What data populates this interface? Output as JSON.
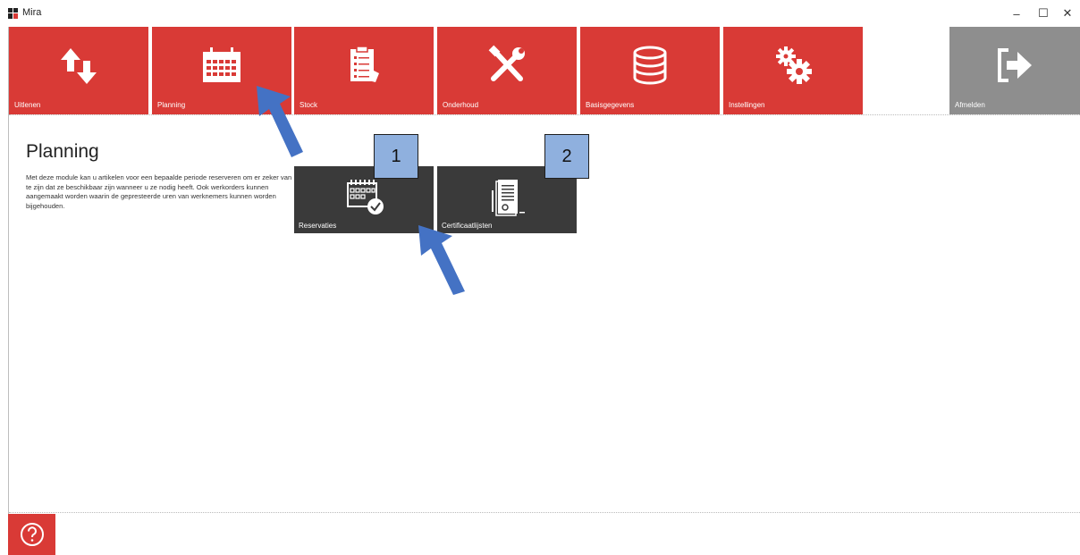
{
  "window": {
    "title": "Mira",
    "minimize_glyph": "–",
    "maximize_glyph": "☐",
    "close_glyph": "✕"
  },
  "nav": {
    "tiles": [
      {
        "label": "Uitlenen",
        "icon": "up-down-arrows-icon"
      },
      {
        "label": "Planning",
        "icon": "calendar-icon"
      },
      {
        "label": "Stock",
        "icon": "clipboard-list-icon"
      },
      {
        "label": "Onderhoud",
        "icon": "tools-icon"
      },
      {
        "label": "Basisgegevens",
        "icon": "database-icon"
      },
      {
        "label": "Instellingen",
        "icon": "gears-icon"
      }
    ],
    "logout": {
      "label": "Afmelden",
      "icon": "logout-icon"
    }
  },
  "page": {
    "title": "Planning",
    "description": "Met deze module kan u artikelen voor een bepaalde periode reserveren om er zeker van te zijn dat ze beschikbaar zijn wanneer u ze nodig heeft. Ook werkorders kunnen aangemaakt worden waarin de gepresteerde uren van werknemers kunnen worden bijgehouden."
  },
  "subtiles": [
    {
      "label": "Reservaties",
      "icon": "calendar-check-icon"
    },
    {
      "label": "Certificaatlijsten",
      "icon": "certificate-icon"
    }
  ],
  "annotations": {
    "badges": [
      "1",
      "2"
    ],
    "badge_color": "#8fb0de",
    "arrow_color": "#4472c4"
  },
  "colors": {
    "tile_red": "#d93a36",
    "tile_grey": "#8e8e8e",
    "subtile_dark": "#3a3a3a"
  },
  "help": {
    "icon": "question-icon"
  }
}
